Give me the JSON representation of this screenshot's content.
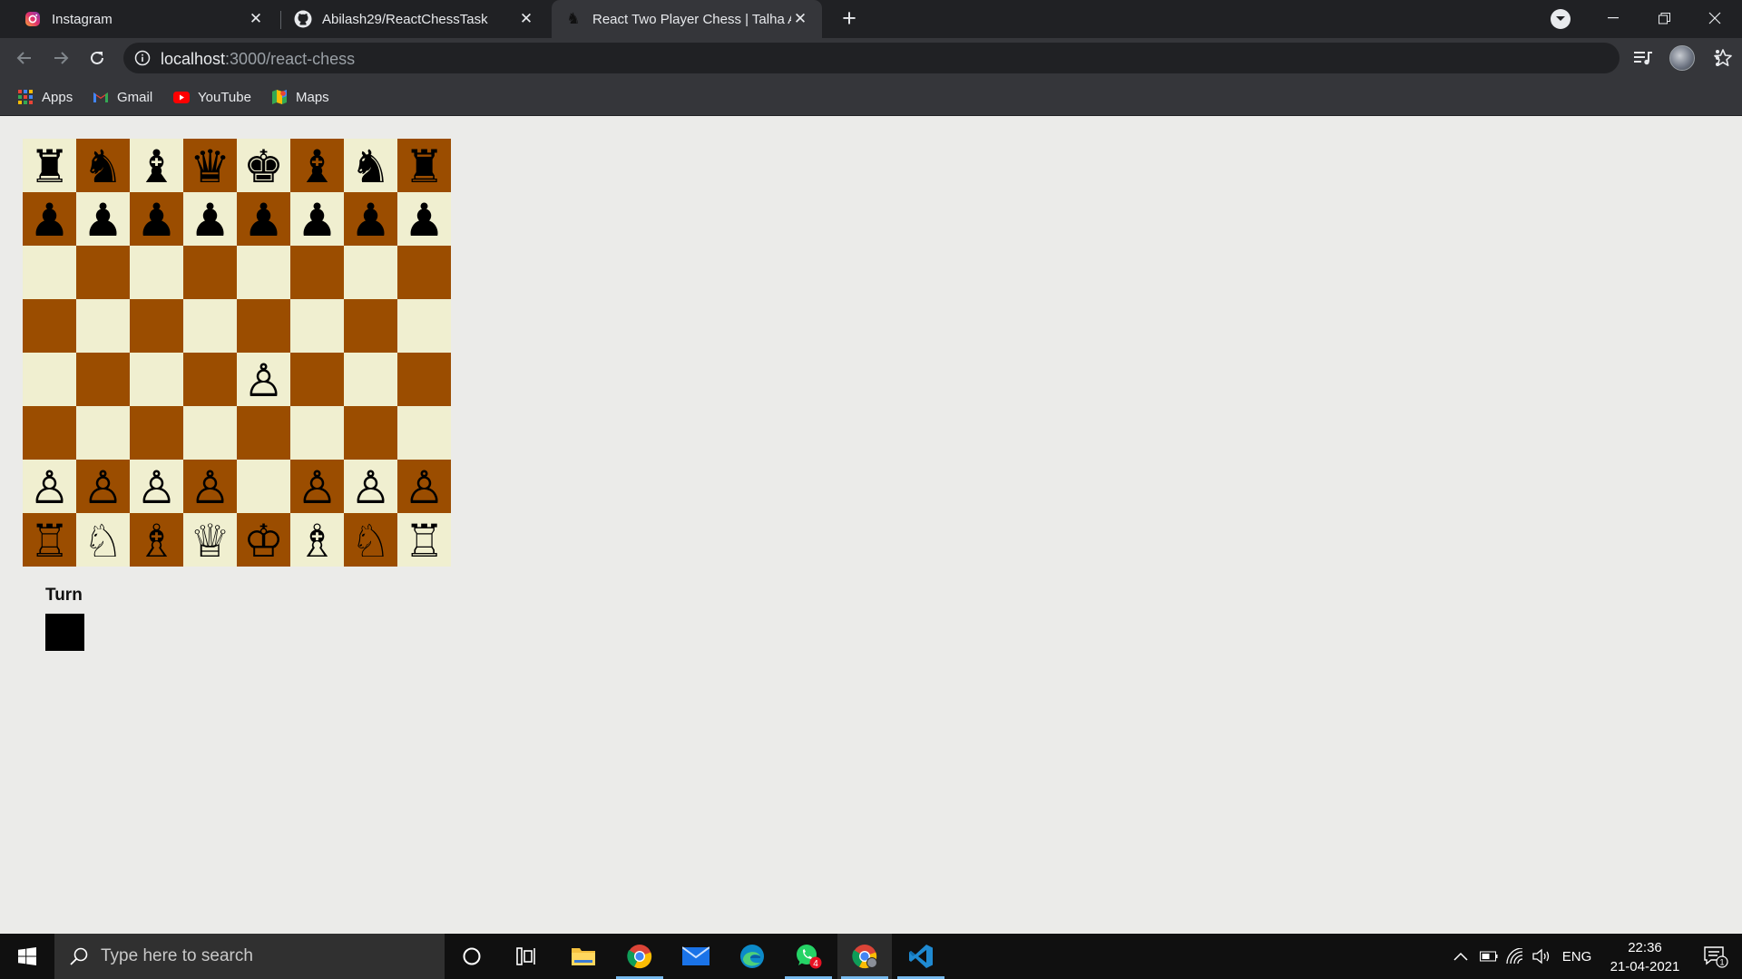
{
  "browser": {
    "tabs": [
      {
        "title": "Instagram",
        "icon": "instagram-icon",
        "active": false
      },
      {
        "title": "Abilash29/ReactChessTask",
        "icon": "github-icon",
        "active": false
      },
      {
        "title": "React Two Player Chess | Talha Aw",
        "icon": "chess-knight-icon",
        "active": true
      }
    ],
    "url": {
      "host": "localhost",
      "path": ":3000/react-chess"
    },
    "bookmarks": [
      {
        "label": "Apps",
        "icon": "apps-grid-icon"
      },
      {
        "label": "Gmail",
        "icon": "gmail-icon"
      },
      {
        "label": "YouTube",
        "icon": "youtube-icon"
      },
      {
        "label": "Maps",
        "icon": "maps-icon"
      }
    ]
  },
  "game": {
    "board": [
      [
        "♜",
        "♞",
        "♝",
        "♛",
        "♚",
        "♝",
        "♞",
        "♜"
      ],
      [
        "♟",
        "♟",
        "♟",
        "♟",
        "♟",
        "♟",
        "♟",
        "♟"
      ],
      [
        "",
        "",
        "",
        "",
        "",
        "",
        "",
        ""
      ],
      [
        "",
        "",
        "",
        "",
        "",
        "",
        "",
        ""
      ],
      [
        "",
        "",
        "",
        "",
        "♙",
        "",
        "",
        ""
      ],
      [
        "",
        "",
        "",
        "",
        "",
        "",
        "",
        ""
      ],
      [
        "♙",
        "♙",
        "♙",
        "♙",
        "",
        "♙",
        "♙",
        "♙"
      ],
      [
        "♖",
        "♘",
        "♗",
        "♕",
        "♔",
        "♗",
        "♘",
        "♖"
      ]
    ],
    "colors": {
      "light": "#f0efd0",
      "dark": "#9b4d00"
    },
    "turn_label": "Turn",
    "turn_color": "black"
  },
  "taskbar": {
    "search_placeholder": "Type here to search",
    "apps": [
      "cortana-icon",
      "task-view-icon",
      "file-explorer-icon",
      "chrome-icon",
      "mail-icon",
      "edge-icon",
      "whatsapp-icon",
      "chrome-profile-icon",
      "vscode-icon"
    ],
    "whatsapp_badge": "4",
    "language": "ENG",
    "time": "22:36",
    "date": "21-04-2021",
    "notification_count": "1"
  }
}
